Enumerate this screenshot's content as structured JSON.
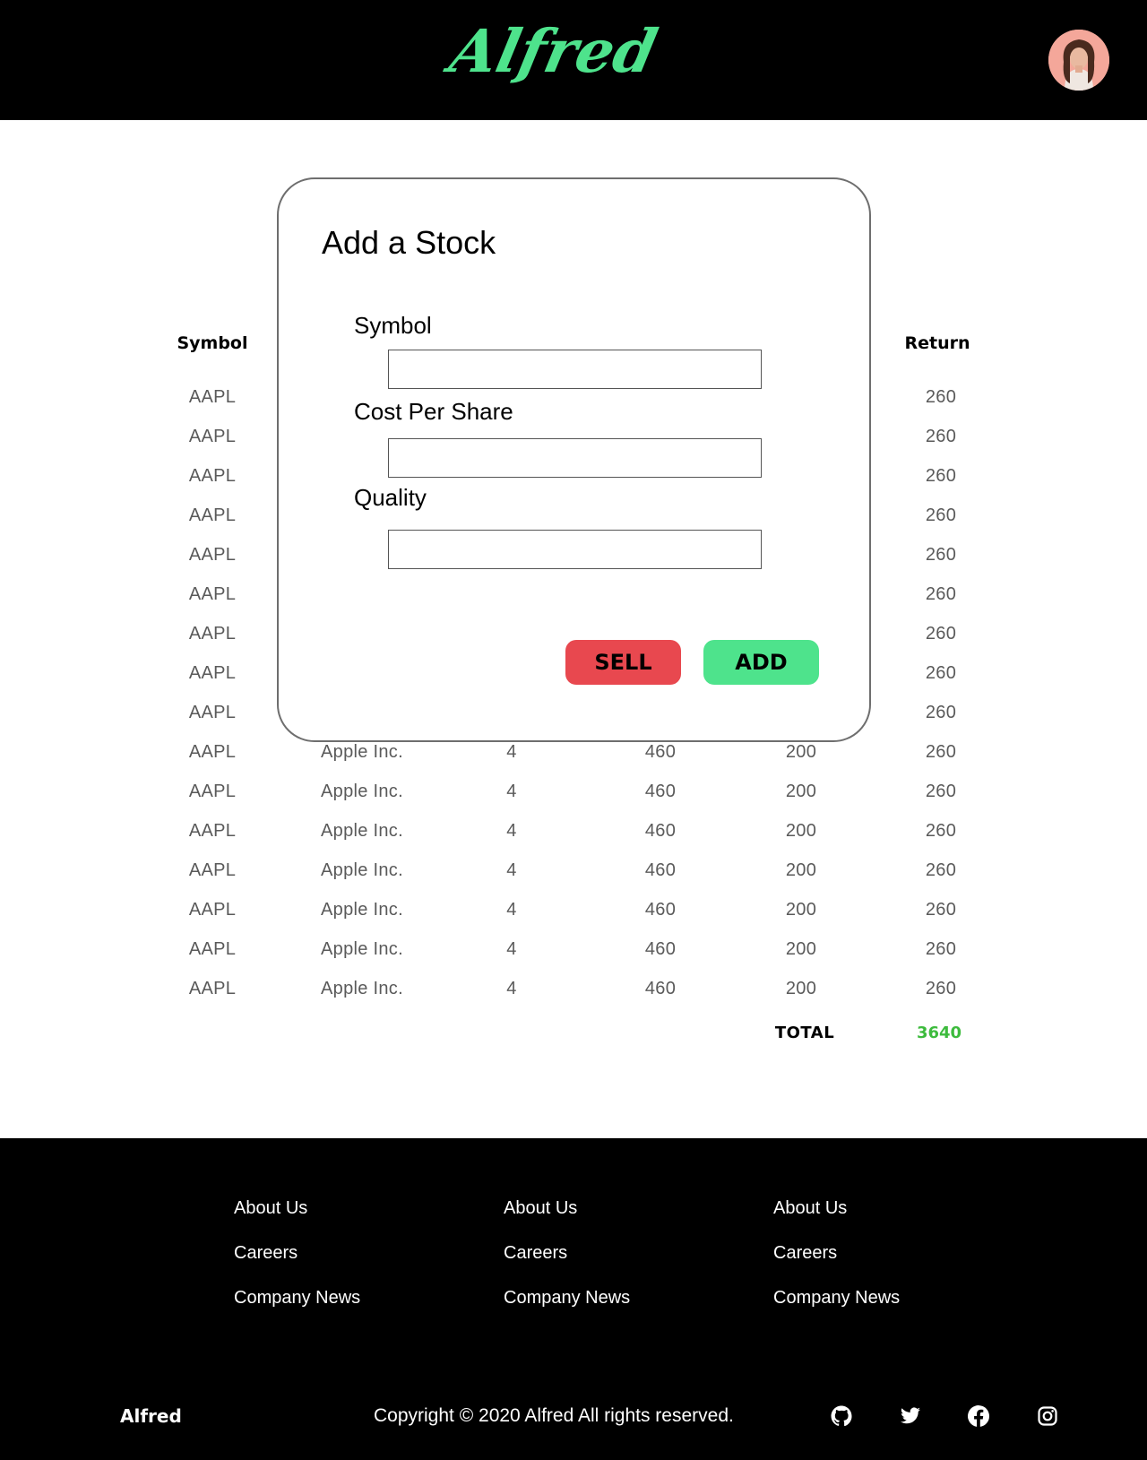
{
  "header": {
    "logo_text": "Alfred",
    "avatar_alt": "user avatar"
  },
  "colors": {
    "brand_green": "#4ee38c",
    "sell_red": "#e8484f",
    "total_green": "#3dbb3d",
    "avatar_bg": "#f4a79a"
  },
  "table": {
    "headers": {
      "symbol": "Symbol",
      "return": "Return"
    },
    "rows": [
      {
        "symbol": "AAPL",
        "name": "",
        "qty": "",
        "price": "",
        "cost": "",
        "ret": "260"
      },
      {
        "symbol": "AAPL",
        "name": "",
        "qty": "",
        "price": "",
        "cost": "",
        "ret": "260"
      },
      {
        "symbol": "AAPL",
        "name": "",
        "qty": "",
        "price": "",
        "cost": "",
        "ret": "260"
      },
      {
        "symbol": "AAPL",
        "name": "",
        "qty": "",
        "price": "",
        "cost": "",
        "ret": "260"
      },
      {
        "symbol": "AAPL",
        "name": "",
        "qty": "",
        "price": "",
        "cost": "",
        "ret": "260"
      },
      {
        "symbol": "AAPL",
        "name": "",
        "qty": "",
        "price": "",
        "cost": "",
        "ret": "260"
      },
      {
        "symbol": "AAPL",
        "name": "",
        "qty": "",
        "price": "",
        "cost": "",
        "ret": "260"
      },
      {
        "symbol": "AAPL",
        "name": "",
        "qty": "",
        "price": "",
        "cost": "",
        "ret": "260"
      },
      {
        "symbol": "AAPL",
        "name": "",
        "qty": "",
        "price": "",
        "cost": "",
        "ret": "260"
      },
      {
        "symbol": "AAPL",
        "name": "Apple Inc.",
        "qty": "4",
        "price": "460",
        "cost": "200",
        "ret": "260"
      },
      {
        "symbol": "AAPL",
        "name": "Apple Inc.",
        "qty": "4",
        "price": "460",
        "cost": "200",
        "ret": "260"
      },
      {
        "symbol": "AAPL",
        "name": "Apple Inc.",
        "qty": "4",
        "price": "460",
        "cost": "200",
        "ret": "260"
      },
      {
        "symbol": "AAPL",
        "name": "Apple Inc.",
        "qty": "4",
        "price": "460",
        "cost": "200",
        "ret": "260"
      },
      {
        "symbol": "AAPL",
        "name": "Apple Inc.",
        "qty": "4",
        "price": "460",
        "cost": "200",
        "ret": "260"
      },
      {
        "symbol": "AAPL",
        "name": "Apple Inc.",
        "qty": "4",
        "price": "460",
        "cost": "200",
        "ret": "260"
      },
      {
        "symbol": "AAPL",
        "name": "Apple Inc.",
        "qty": "4",
        "price": "460",
        "cost": "200",
        "ret": "260"
      }
    ],
    "total_label": "TOTAL",
    "total_value": "3640"
  },
  "modal": {
    "title": "Add a Stock",
    "fields": [
      {
        "label": "Symbol",
        "value": "",
        "placeholder": ""
      },
      {
        "label": "Cost Per Share",
        "value": "",
        "placeholder": ""
      },
      {
        "label": "Quality",
        "value": "",
        "placeholder": ""
      }
    ],
    "sell_label": "SELL",
    "add_label": "ADD"
  },
  "footer": {
    "columns": [
      [
        "About Us",
        "Careers",
        "Company News"
      ],
      [
        "About Us",
        "Careers",
        "Company News"
      ],
      [
        "About Us",
        "Careers",
        "Company News"
      ]
    ],
    "brand": "Alfred",
    "copyright": "Copyright © 2020 Alfred All rights reserved.",
    "social_icons": [
      "github-icon",
      "twitter-icon",
      "facebook-icon",
      "instagram-icon"
    ]
  }
}
